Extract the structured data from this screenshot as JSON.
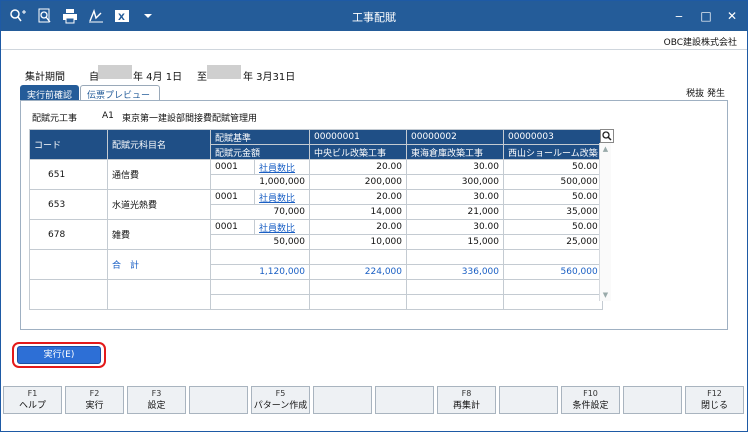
{
  "window": {
    "title": "工事配賦",
    "company": "OBC建設株式会社",
    "controls": [
      "‒",
      "□",
      "✕"
    ],
    "toolbar_icons": [
      "search-plus-icon",
      "zoom-icon",
      "print-icon",
      "signature-icon",
      "excel-icon",
      "menu-chevron-icon"
    ]
  },
  "period": {
    "label": "集計期間",
    "from_prefix": "自",
    "from_suffix": "年 4月 1日",
    "to_prefix": "至",
    "to_suffix": "年 3月31日"
  },
  "tabs": [
    "実行前確認",
    "伝票プレビュー"
  ],
  "tax_mode": "税抜 発生",
  "dept": {
    "label": "配賦元工事",
    "code": "A1",
    "name": "東京第一建設部間接費配賦管理用"
  },
  "grid": {
    "col_code": "コード",
    "col_name": "配賦元科目名",
    "col_basis": "配賦基準",
    "col_amount": "配賦元金額",
    "projects": [
      {
        "code": "00000001",
        "name": "中央ビル改築工事"
      },
      {
        "code": "00000002",
        "name": "東海倉庫改築工事"
      },
      {
        "code": "00000003",
        "name": "西山ショールーム改築"
      }
    ],
    "rows": [
      {
        "code": "651",
        "name": "通信費",
        "basis_code": "0001",
        "basis_name": "社員数比",
        "amount": "1,000,000",
        "ratios": [
          "20.00",
          "30.00",
          "50.00"
        ],
        "values": [
          "200,000",
          "300,000",
          "500,000"
        ]
      },
      {
        "code": "653",
        "name": "水道光熱費",
        "basis_code": "0001",
        "basis_name": "社員数比",
        "amount": "70,000",
        "ratios": [
          "20.00",
          "30.00",
          "50.00"
        ],
        "values": [
          "14,000",
          "21,000",
          "35,000"
        ]
      },
      {
        "code": "678",
        "name": "雑費",
        "basis_code": "0001",
        "basis_name": "社員数比",
        "amount": "50,000",
        "ratios": [
          "20.00",
          "30.00",
          "50.00"
        ],
        "values": [
          "10,000",
          "15,000",
          "25,000"
        ]
      }
    ],
    "total": {
      "label": "合　計",
      "amount": "1,120,000",
      "values": [
        "224,000",
        "336,000",
        "560,000"
      ]
    }
  },
  "execute_button": "実行(E)",
  "fkeys": [
    {
      "key": "F1",
      "label": "ヘルプ"
    },
    {
      "key": "F2",
      "label": "実行"
    },
    {
      "key": "F3",
      "label": "設定"
    },
    {
      "key": "",
      "label": ""
    },
    {
      "key": "F5",
      "label": "パターン作成"
    },
    {
      "key": "",
      "label": ""
    },
    {
      "key": "",
      "label": ""
    },
    {
      "key": "F8",
      "label": "再集計"
    },
    {
      "key": "",
      "label": ""
    },
    {
      "key": "F10",
      "label": "条件設定"
    },
    {
      "key": "",
      "label": ""
    },
    {
      "key": "F12",
      "label": "閉じる"
    }
  ]
}
